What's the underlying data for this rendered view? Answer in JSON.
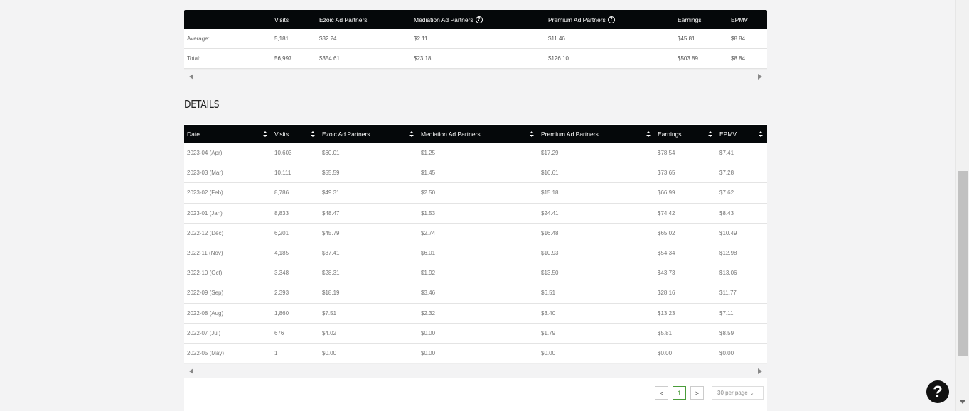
{
  "summary": {
    "headers": [
      "",
      "Visits",
      "Ezoic Ad Partners",
      "Mediation Ad Partners",
      "Premium Ad Partners",
      "Earnings",
      "EPMV"
    ],
    "rows": [
      {
        "label": "Average:",
        "visits": "5,181",
        "ezoic": "$32.24",
        "mediation": "$2.11",
        "premium": "$11.46",
        "earnings": "$45.81",
        "epmv": "$8.84"
      },
      {
        "label": "Total:",
        "visits": "56,997",
        "ezoic": "$354.61",
        "mediation": "$23.18",
        "premium": "$126.10",
        "earnings": "$503.89",
        "epmv": "$8.84"
      }
    ]
  },
  "details": {
    "title": "DETAILS",
    "headers": [
      "Date",
      "Visits",
      "Ezoic Ad Partners",
      "Mediation Ad Partners",
      "Premium Ad Partners",
      "Earnings",
      "EPMV"
    ],
    "rows": [
      {
        "date": "2023-04 (Apr)",
        "visits": "10,603",
        "ezoic": "$60.01",
        "mediation": "$1.25",
        "premium": "$17.29",
        "earnings": "$78.54",
        "epmv": "$7.41"
      },
      {
        "date": "2023-03 (Mar)",
        "visits": "10,111",
        "ezoic": "$55.59",
        "mediation": "$1.45",
        "premium": "$16.61",
        "earnings": "$73.65",
        "epmv": "$7.28"
      },
      {
        "date": "2023-02 (Feb)",
        "visits": "8,786",
        "ezoic": "$49.31",
        "mediation": "$2.50",
        "premium": "$15.18",
        "earnings": "$66.99",
        "epmv": "$7.62"
      },
      {
        "date": "2023-01 (Jan)",
        "visits": "8,833",
        "ezoic": "$48.47",
        "mediation": "$1.53",
        "premium": "$24.41",
        "earnings": "$74.42",
        "epmv": "$8.43"
      },
      {
        "date": "2022-12 (Dec)",
        "visits": "6,201",
        "ezoic": "$45.79",
        "mediation": "$2.74",
        "premium": "$16.48",
        "earnings": "$65.02",
        "epmv": "$10.49"
      },
      {
        "date": "2022-11 (Nov)",
        "visits": "4,185",
        "ezoic": "$37.41",
        "mediation": "$6.01",
        "premium": "$10.93",
        "earnings": "$54.34",
        "epmv": "$12.98"
      },
      {
        "date": "2022-10 (Oct)",
        "visits": "3,348",
        "ezoic": "$28.31",
        "mediation": "$1.92",
        "premium": "$13.50",
        "earnings": "$43.73",
        "epmv": "$13.06"
      },
      {
        "date": "2022-09 (Sep)",
        "visits": "2,393",
        "ezoic": "$18.19",
        "mediation": "$3.46",
        "premium": "$6.51",
        "earnings": "$28.16",
        "epmv": "$11.77"
      },
      {
        "date": "2022-08 (Aug)",
        "visits": "1,860",
        "ezoic": "$7.51",
        "mediation": "$2.32",
        "premium": "$3.40",
        "earnings": "$13.23",
        "epmv": "$7.11"
      },
      {
        "date": "2022-07 (Jul)",
        "visits": "676",
        "ezoic": "$4.02",
        "mediation": "$0.00",
        "premium": "$1.79",
        "earnings": "$5.81",
        "epmv": "$8.59"
      },
      {
        "date": "2022-05 (May)",
        "visits": "1",
        "ezoic": "$0.00",
        "mediation": "$0.00",
        "premium": "$0.00",
        "earnings": "$0.00",
        "epmv": "$0.00"
      }
    ]
  },
  "pagination": {
    "prev": "<",
    "current_page": "1",
    "next": ">",
    "per_page": "30 per page"
  },
  "help_button": "?",
  "icons": {
    "help": "question-circle-icon",
    "sort": "sort-arrows-icon",
    "chevron": "chevron-down-icon"
  },
  "colors": {
    "header_bg": "#05080a",
    "active_page": "#4a9c3a",
    "page_bg": "#f3f3f4"
  }
}
